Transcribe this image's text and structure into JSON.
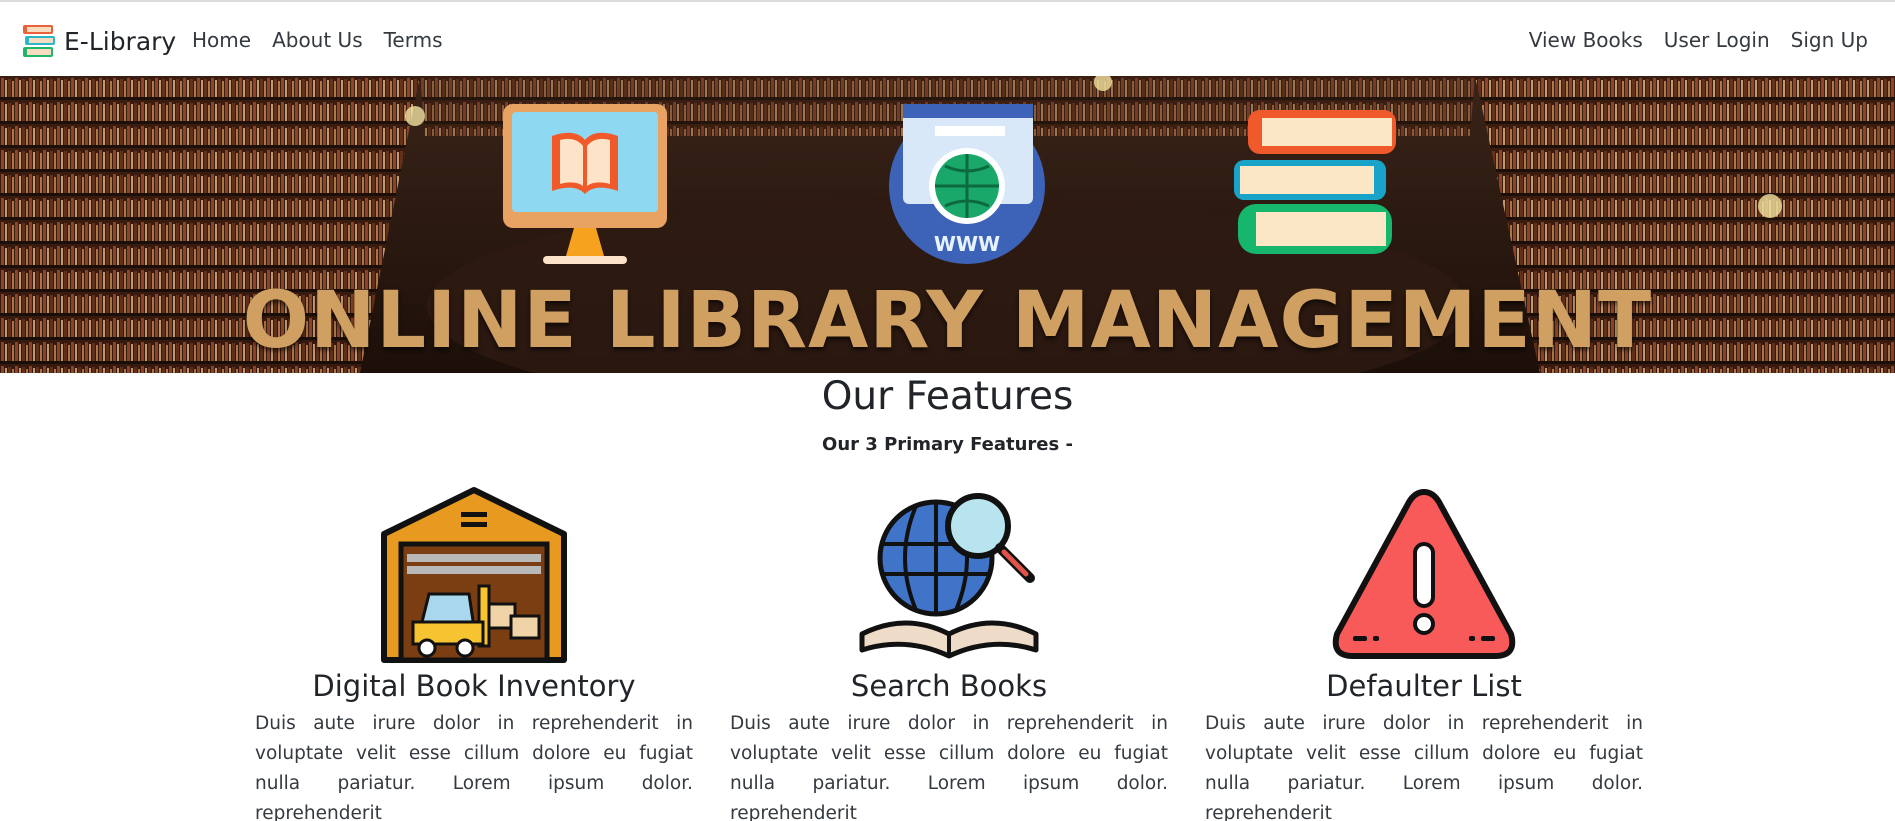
{
  "navbar": {
    "brand_icon": "books-stack-icon",
    "brand": "E-Library",
    "left_links": [
      "Home",
      "About Us",
      "Terms"
    ],
    "right_links": [
      "View Books",
      "User Login",
      "Sign Up"
    ]
  },
  "hero": {
    "title": "ONLINE LIBRARY MANAGEMENT",
    "icons": [
      "monitor-book-icon",
      "www-globe-icon",
      "book-stack-icon"
    ],
    "title_color": "#cfa062"
  },
  "features": {
    "heading": "Our Features",
    "subheading": "Our 3 Primary Features -",
    "items": [
      {
        "icon": "warehouse-inventory-icon",
        "title": "Digital Book Inventory",
        "text": "Duis aute irure dolor in reprehenderit in voluptate velit esse cillum dolore eu fugiat nulla pariatur. Lorem ipsum dolor. reprehenderit"
      },
      {
        "icon": "globe-search-book-icon",
        "title": "Search Books",
        "text": "Duis aute irure dolor in reprehenderit in voluptate velit esse cillum dolore eu fugiat nulla pariatur. Lorem ipsum dolor. reprehenderit"
      },
      {
        "icon": "warning-triangle-icon",
        "title": "Defaulter List",
        "text": "Duis aute irure dolor in reprehenderit in voluptate velit esse cillum dolore eu fugiat nulla pariatur. Lorem ipsum dolor. reprehenderit"
      }
    ]
  }
}
